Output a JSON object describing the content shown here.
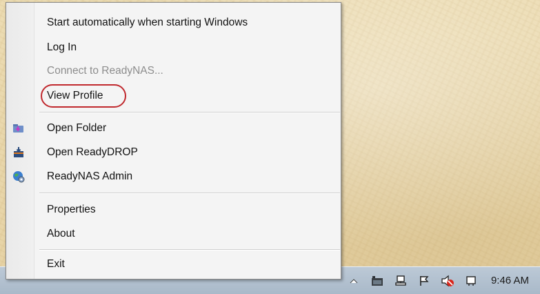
{
  "menu": {
    "items": [
      {
        "label": "Start automatically when starting Windows",
        "enabled": true
      },
      {
        "label": "Log In",
        "enabled": true
      },
      {
        "label": "Connect to ReadyNAS...",
        "enabled": false
      },
      {
        "label": "View Profile",
        "enabled": true,
        "highlighted": true
      },
      {
        "label": "Open Folder",
        "enabled": true,
        "icon": "folder-down-icon"
      },
      {
        "label": "Open ReadyDROP",
        "enabled": true,
        "icon": "readydrop-icon"
      },
      {
        "label": "ReadyNAS Admin",
        "enabled": true,
        "icon": "globe-gear-icon"
      },
      {
        "label": "Properties",
        "enabled": true
      },
      {
        "label": "About",
        "enabled": true
      },
      {
        "label": "Exit",
        "enabled": true
      }
    ]
  },
  "taskbar": {
    "tray_icons": [
      "show-hidden-icons-arrow",
      "app-tray-icon",
      "network-icon",
      "action-center-flag-icon",
      "volume-muted-icon",
      "power-icon"
    ],
    "clock": "9:46 AM"
  },
  "colors": {
    "highlight_ring": "#c0282d",
    "disabled_text": "#8d8d8d"
  }
}
